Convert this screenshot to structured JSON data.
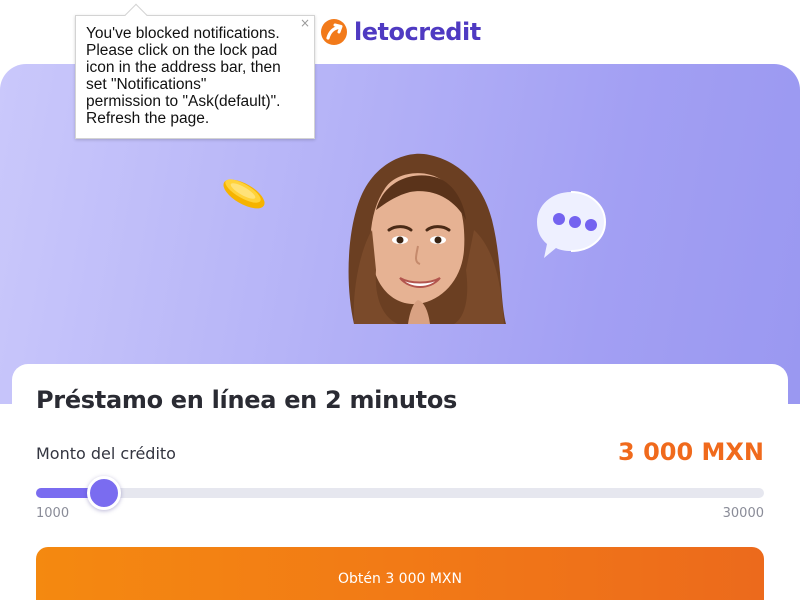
{
  "header": {
    "brand": "letocredit"
  },
  "tooltip": {
    "message": "You've blocked notifications.\nPlease click on the lock pad\nicon in the address bar, then\nset \"Notifications\"\npermission to \"Ask(default)\".\nRefresh the page.",
    "close_label": "×"
  },
  "loan_card": {
    "title": "Préstamo en línea en 2 minutos",
    "amount_label": "Monto del crédito",
    "amount_value": "3 000 MXN",
    "slider": {
      "min_label": "1000",
      "max_label": "30000",
      "min": 1000,
      "max": 30000,
      "value": 3000
    },
    "cta_label": "Obtén 3 000 MXN"
  },
  "colors": {
    "brand_purple": "#4f3ac2",
    "brand_orange": "#f27a1a",
    "slider_accent": "#7a6cf0",
    "amount_orange": "#f06a1c"
  },
  "icons": [
    "logo-mark-icon",
    "coin-icon",
    "chat-bubble-icon",
    "close-icon"
  ]
}
